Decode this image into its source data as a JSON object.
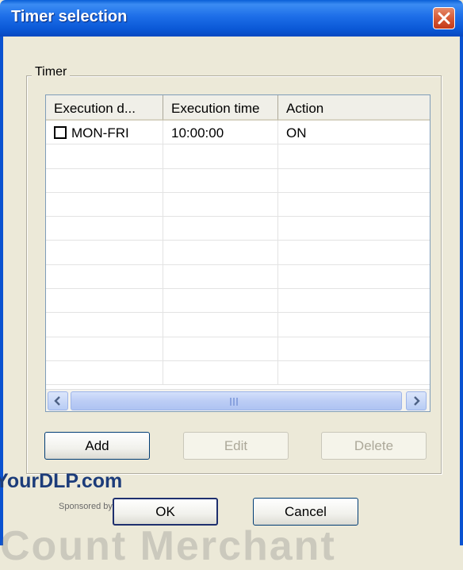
{
  "window": {
    "title": "Timer selection"
  },
  "group": {
    "label": "Timer"
  },
  "table": {
    "columns": [
      "Execution d...",
      "Execution time",
      "Action"
    ],
    "rows": [
      {
        "day": "MON-FRI",
        "time": "10:00:00",
        "action": "ON",
        "checked": false
      }
    ]
  },
  "buttons": {
    "add": "Add",
    "edit": "Edit",
    "delete": "Delete",
    "ok": "OK",
    "cancel": "Cancel"
  },
  "watermark": {
    "site": "YourDLP.com",
    "sponsor": "Sponsored by",
    "banner": "Count Merchant"
  },
  "colors": {
    "titlebar": "#0a58d6",
    "close": "#d65a36",
    "dialog_bg": "#ece9d8"
  }
}
